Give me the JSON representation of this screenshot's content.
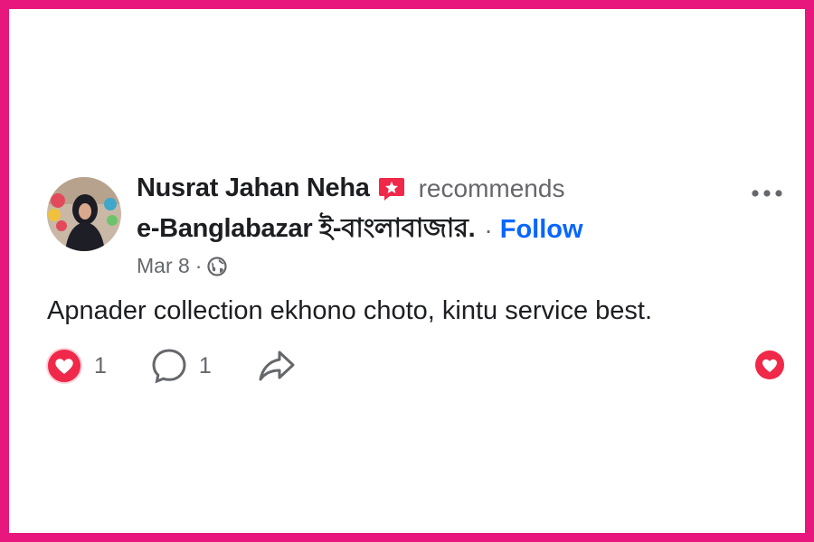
{
  "post": {
    "author": "Nusrat Jahan Neha",
    "action": "recommends",
    "page_name": "e-Banglabazar ই-বাংলাবাজার.",
    "separator": "·",
    "follow_label": "Follow",
    "date": "Mar 8",
    "meta_separator": "·",
    "privacy_icon": "globe-icon",
    "text": "Apnader collection ekhono choto, kintu service best."
  },
  "actions": {
    "like_count": "1",
    "comment_count": "1"
  },
  "colors": {
    "frame": "#e8177e",
    "link": "#0866ff",
    "reaction": "#f02849",
    "text": "#1c1e21",
    "muted": "#65676b"
  }
}
